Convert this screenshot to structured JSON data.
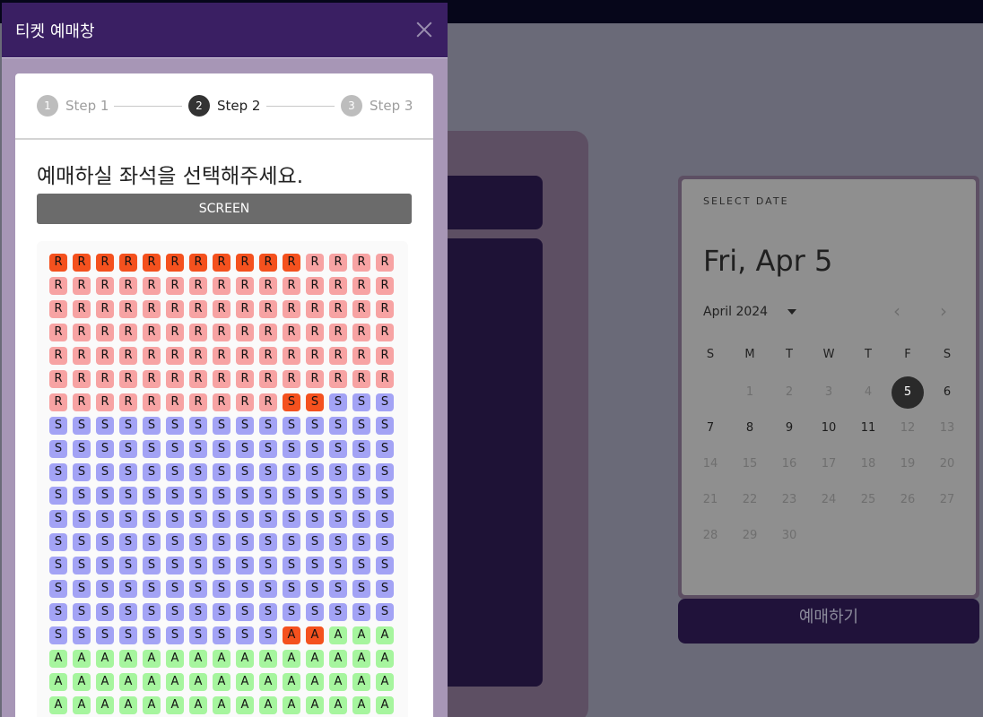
{
  "dialog": {
    "title": "티켓 예매창",
    "steps": [
      {
        "num": "1",
        "label": "Step 1",
        "active": false
      },
      {
        "num": "2",
        "label": "Step 2",
        "active": true
      },
      {
        "num": "3",
        "label": "Step 3",
        "active": false
      }
    ],
    "prompt": "예매하실 좌석을 선택해주세요.",
    "screen_label": "SCREEN"
  },
  "seats": {
    "columns": 15,
    "rows": [
      "RRRRRRRRRRRRRRR",
      "RRRRRRRRRRRRRRR",
      "RRRRRRRRRRRRRRR",
      "RRRRRRRRRRRRRRR",
      "RRRRRRRRRRRRRRR",
      "RRRRRRRRRRRRRRR",
      "RRRRRRRRRRSSSSS",
      "SSSSSSSSSSSSSSS",
      "SSSSSSSSSSSSSSS",
      "SSSSSSSSSSSSSSS",
      "SSSSSSSSSSSSSSS",
      "SSSSSSSSSSSSSSS",
      "SSSSSSSSSSSSSSS",
      "SSSSSSSSSSSSSSS",
      "SSSSSSSSSSSSSSS",
      "SSSSSSSSSSSSSSS",
      "SSSSSSSSSSAAAAA",
      "AAAAAAAAAAAAAAA",
      "AAAAAAAAAAAAAAA",
      "AAAAAAAAAAAAAAA"
    ],
    "taken": [
      [
        0,
        0
      ],
      [
        0,
        1
      ],
      [
        0,
        2
      ],
      [
        0,
        3
      ],
      [
        0,
        4
      ],
      [
        0,
        5
      ],
      [
        0,
        6
      ],
      [
        0,
        7
      ],
      [
        0,
        8
      ],
      [
        0,
        9
      ],
      [
        0,
        10
      ],
      [
        6,
        10
      ],
      [
        6,
        11
      ],
      [
        16,
        10
      ],
      [
        16,
        11
      ]
    ],
    "colors": {
      "R": "#f7a3a3",
      "S": "#a3a3f5",
      "A": "#a6f59e",
      "taken": "#f4511e"
    }
  },
  "datepicker": {
    "select_label": "SELECT DATE",
    "selected_date": "Fri, Apr 5",
    "month_label": "April 2024",
    "weekdays": [
      "S",
      "M",
      "T",
      "W",
      "T",
      "F",
      "S"
    ],
    "leading_blanks": 1,
    "days": [
      {
        "d": "1",
        "avail": false
      },
      {
        "d": "2",
        "avail": false
      },
      {
        "d": "3",
        "avail": false
      },
      {
        "d": "4",
        "avail": false
      },
      {
        "d": "5",
        "avail": true,
        "selected": true
      },
      {
        "d": "6",
        "avail": true
      },
      {
        "d": "7",
        "avail": true
      },
      {
        "d": "8",
        "avail": true
      },
      {
        "d": "9",
        "avail": true
      },
      {
        "d": "10",
        "avail": true
      },
      {
        "d": "11",
        "avail": true
      },
      {
        "d": "12",
        "avail": false
      },
      {
        "d": "13",
        "avail": false
      },
      {
        "d": "14",
        "avail": false
      },
      {
        "d": "15",
        "avail": false
      },
      {
        "d": "16",
        "avail": false
      },
      {
        "d": "17",
        "avail": false
      },
      {
        "d": "18",
        "avail": false
      },
      {
        "d": "19",
        "avail": false
      },
      {
        "d": "20",
        "avail": false
      },
      {
        "d": "21",
        "avail": false
      },
      {
        "d": "22",
        "avail": false
      },
      {
        "d": "23",
        "avail": false
      },
      {
        "d": "24",
        "avail": false
      },
      {
        "d": "25",
        "avail": false
      },
      {
        "d": "26",
        "avail": false
      },
      {
        "d": "27",
        "avail": false
      },
      {
        "d": "28",
        "avail": false
      },
      {
        "d": "29",
        "avail": false
      },
      {
        "d": "30",
        "avail": false
      }
    ]
  },
  "book_button_label": "예매하기"
}
